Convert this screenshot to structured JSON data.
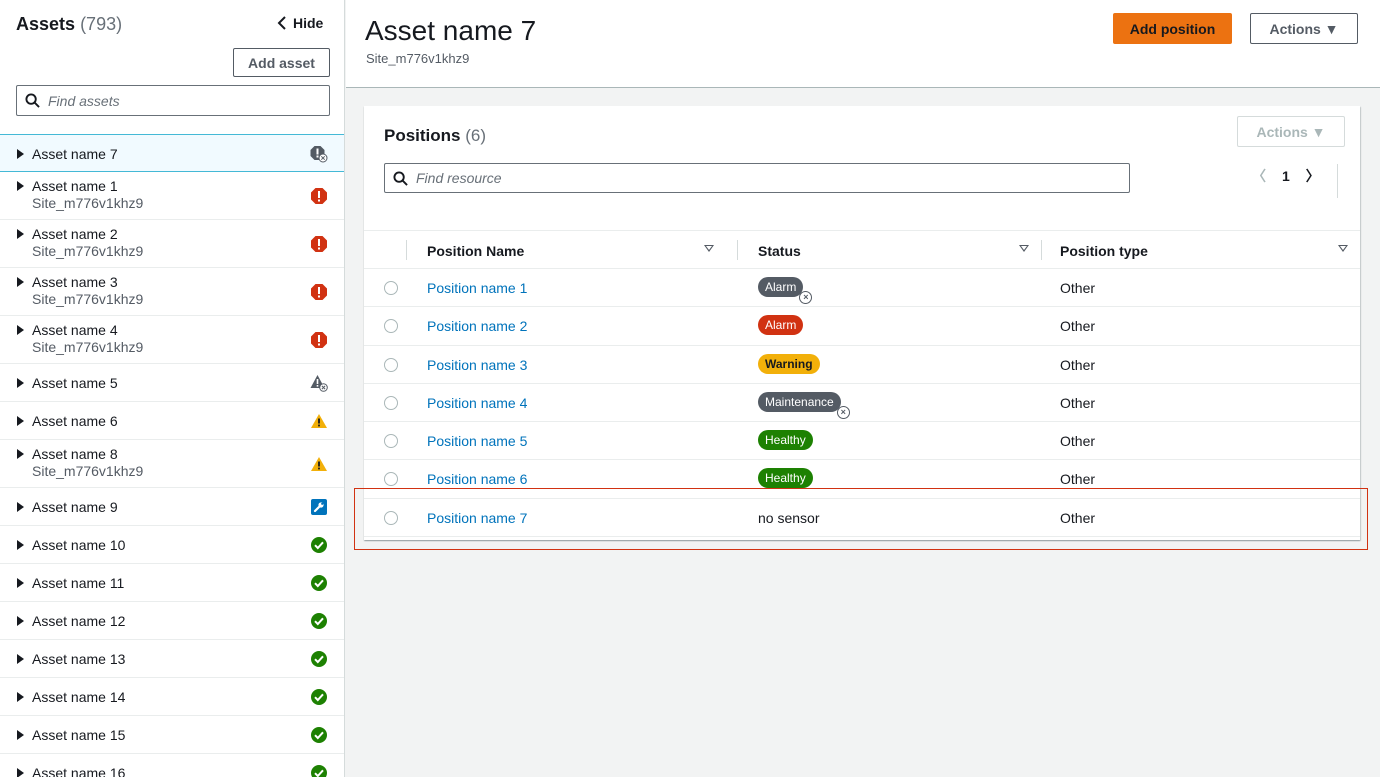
{
  "sidebar": {
    "title": "Assets",
    "count": "(793)",
    "hide_label": "Hide",
    "add_asset_label": "Add asset",
    "search_placeholder": "Find assets",
    "items": [
      {
        "name": "Asset name 7",
        "site": "",
        "status": "critical-muted",
        "selected": true
      },
      {
        "name": "Asset name 1",
        "site": "Site_m776v1khz9",
        "status": "critical"
      },
      {
        "name": "Asset name 2",
        "site": "Site_m776v1khz9",
        "status": "critical"
      },
      {
        "name": "Asset name 3",
        "site": "Site_m776v1khz9",
        "status": "critical"
      },
      {
        "name": "Asset name 4",
        "site": "Site_m776v1khz9",
        "status": "critical"
      },
      {
        "name": "Asset name 5",
        "site": "",
        "status": "warning-muted"
      },
      {
        "name": "Asset name 6",
        "site": "",
        "status": "warning"
      },
      {
        "name": "Asset name 8",
        "site": "Site_m776v1khz9",
        "status": "warning"
      },
      {
        "name": "Asset name 9",
        "site": "",
        "status": "maintenance"
      },
      {
        "name": "Asset name 10",
        "site": "",
        "status": "healthy"
      },
      {
        "name": "Asset name 11",
        "site": "",
        "status": "healthy"
      },
      {
        "name": "Asset name 12",
        "site": "",
        "status": "healthy"
      },
      {
        "name": "Asset name 13",
        "site": "",
        "status": "healthy"
      },
      {
        "name": "Asset name 14",
        "site": "",
        "status": "healthy"
      },
      {
        "name": "Asset name 15",
        "site": "",
        "status": "healthy"
      },
      {
        "name": "Asset name 16",
        "site": "",
        "status": "healthy"
      }
    ]
  },
  "header": {
    "title": "Asset name 7",
    "subtitle": "Site_m776v1khz9",
    "add_position_label": "Add position",
    "actions_label": "Actions ▼"
  },
  "positions": {
    "title": "Positions",
    "count": "(6)",
    "actions_label": "Actions ▼",
    "search_placeholder": "Find resource",
    "page": "1",
    "columns": [
      "Position Name",
      "Status",
      "Position type"
    ],
    "rows": [
      {
        "name": "Position name 1",
        "status": "Alarm",
        "status_style": "gray-muted",
        "type": "Other"
      },
      {
        "name": "Position name 2",
        "status": "Alarm",
        "status_style": "red",
        "type": "Other"
      },
      {
        "name": "Position name 3",
        "status": "Warning",
        "status_style": "yellow",
        "type": "Other"
      },
      {
        "name": "Position name 4",
        "status": "Maintenance",
        "status_style": "gray-muted",
        "type": "Other"
      },
      {
        "name": "Position name 5",
        "status": "Healthy",
        "status_style": "green",
        "type": "Other"
      },
      {
        "name": "Position name 6",
        "status": "Healthy",
        "status_style": "green",
        "type": "Other"
      },
      {
        "name": "Position name 7",
        "status": "no sensor",
        "status_style": "plain",
        "type": "Other"
      }
    ]
  },
  "colors": {
    "critical": "#d13212",
    "warning": "#f2b00a",
    "healthy": "#1d8102",
    "maintenance": "#0073bb",
    "muted": "#545b64",
    "primary": "#ec7211",
    "link": "#0073bb"
  }
}
